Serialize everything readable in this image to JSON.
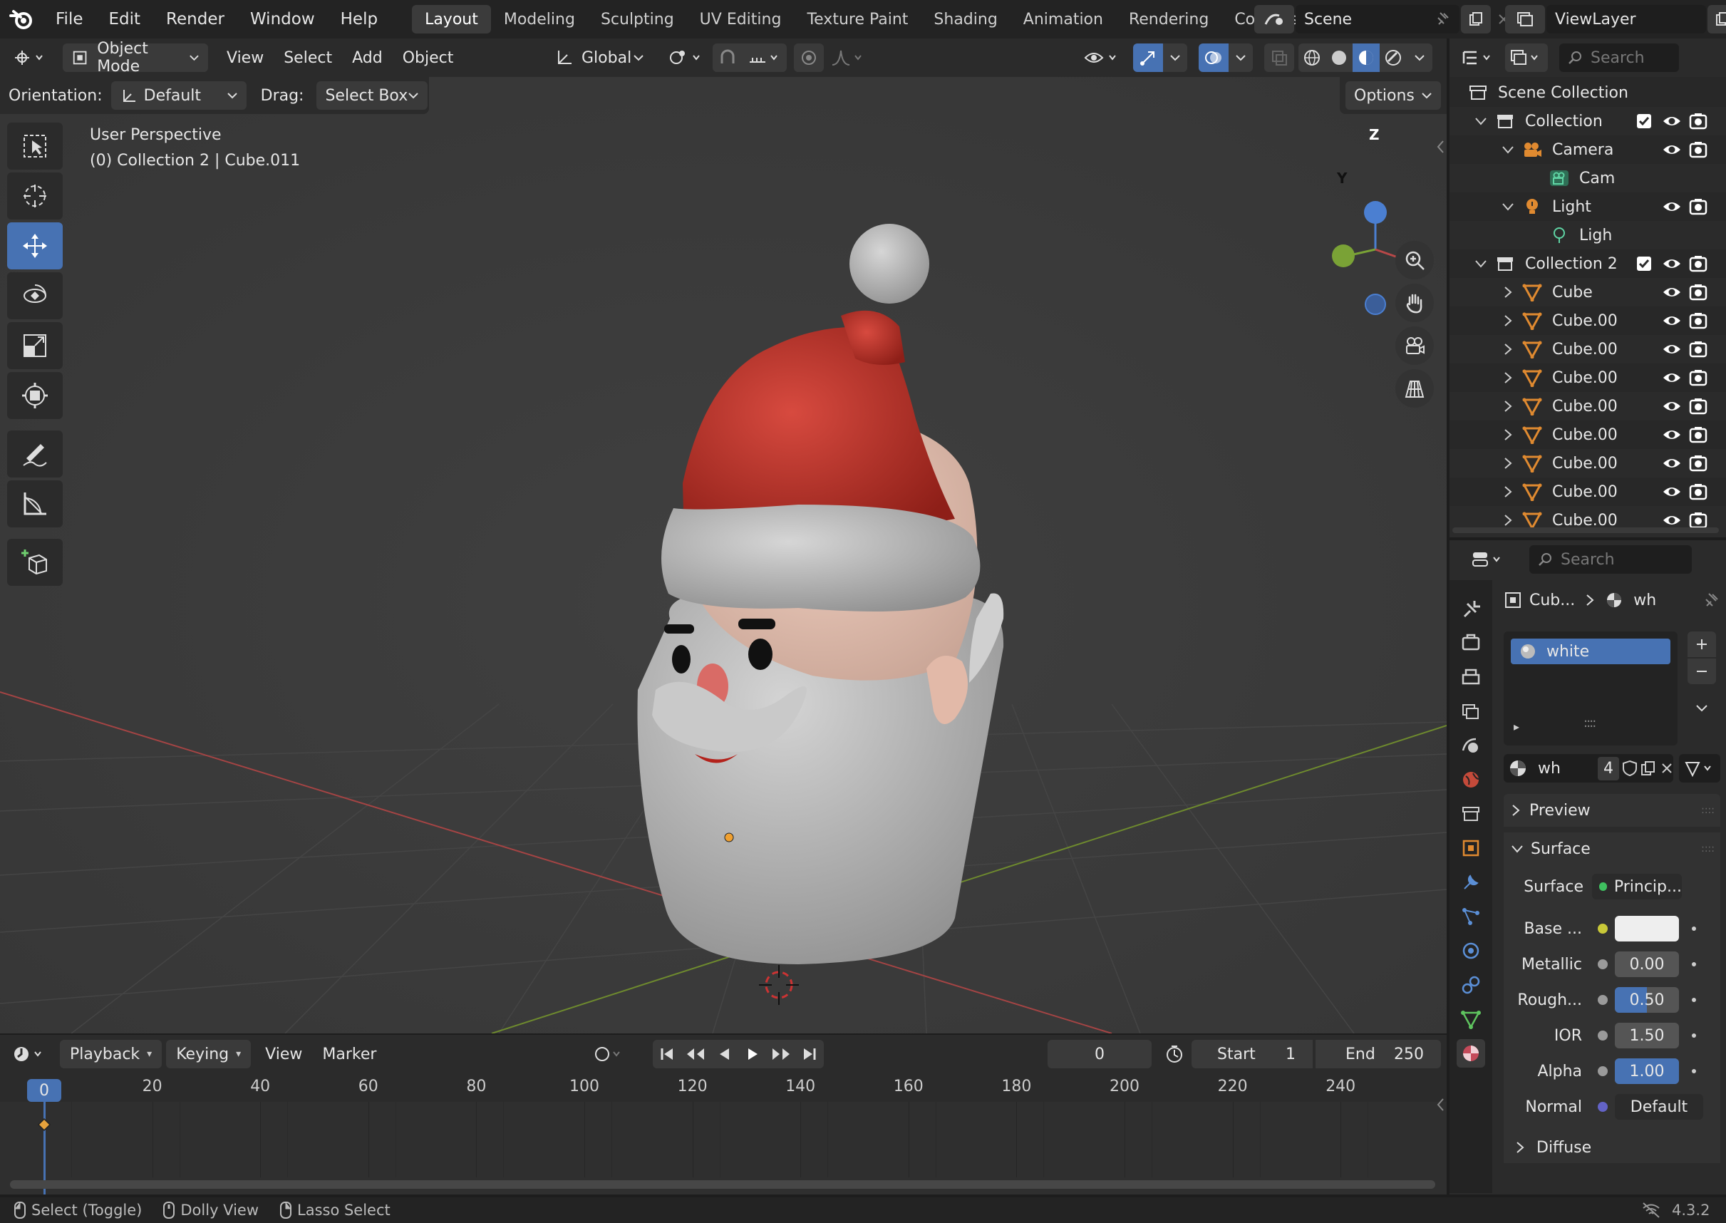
{
  "top_menu": [
    "File",
    "Edit",
    "Render",
    "Window",
    "Help"
  ],
  "workspaces": [
    {
      "label": "Layout",
      "active": true
    },
    {
      "label": "Modeling"
    },
    {
      "label": "Sculpting"
    },
    {
      "label": "UV Editing"
    },
    {
      "label": "Texture Paint"
    },
    {
      "label": "Shading"
    },
    {
      "label": "Animation"
    },
    {
      "label": "Rendering"
    },
    {
      "label": "Compositi"
    }
  ],
  "scene_name": "Scene",
  "view_layer": "ViewLayer",
  "viewport_header": {
    "mode": "Object Mode",
    "menus": [
      "View",
      "Select",
      "Add",
      "Object"
    ],
    "transform": "Global"
  },
  "tool_settings": {
    "orientation_label": "Orientation:",
    "orientation_value": "Default",
    "drag_label": "Drag:",
    "drag_value": "Select Box",
    "options": "Options"
  },
  "viewport_info": {
    "line1": "User Perspective",
    "line2": "(0) Collection 2 | Cube.011"
  },
  "gizmo": {
    "z": "Z",
    "y": "Y"
  },
  "outliner": {
    "search_placeholder": "Search",
    "rows": [
      {
        "label": "Scene Collection",
        "type": "scene",
        "indent": 0
      },
      {
        "label": "Collection",
        "type": "collection",
        "indent": 1,
        "expanded": true
      },
      {
        "label": "Camera",
        "type": "camera",
        "indent": 2,
        "expanded": true
      },
      {
        "label": "Cam",
        "type": "camera-data",
        "indent": 3
      },
      {
        "label": "Light",
        "type": "light",
        "indent": 2,
        "expanded": true
      },
      {
        "label": "Ligh",
        "type": "light-data",
        "indent": 3
      },
      {
        "label": "Collection 2",
        "type": "collection",
        "indent": 1,
        "expanded": true
      },
      {
        "label": "Cube",
        "type": "mesh",
        "indent": 2
      },
      {
        "label": "Cube.00",
        "type": "mesh",
        "indent": 2
      },
      {
        "label": "Cube.00",
        "type": "mesh",
        "indent": 2
      },
      {
        "label": "Cube.00",
        "type": "mesh",
        "indent": 2
      },
      {
        "label": "Cube.00",
        "type": "mesh",
        "indent": 2
      },
      {
        "label": "Cube.00",
        "type": "mesh",
        "indent": 2
      },
      {
        "label": "Cube.00",
        "type": "mesh",
        "indent": 2
      },
      {
        "label": "Cube.00",
        "type": "mesh",
        "indent": 2
      },
      {
        "label": "Cube.00",
        "type": "mesh",
        "indent": 2
      }
    ]
  },
  "properties": {
    "search_placeholder": "Search",
    "breadcrumb_object": "Cub...",
    "breadcrumb_material": "wh",
    "material_slot": "white",
    "material_name": "wh",
    "material_users": "4",
    "panels": {
      "preview": "Preview",
      "surface": "Surface",
      "diffuse": "Diffuse"
    },
    "surface_label": "Surface",
    "surface_value": "Princip...",
    "fields": [
      {
        "label": "Base ...",
        "value": "",
        "type": "color",
        "dot": "#c8c838"
      },
      {
        "label": "Metallic",
        "value": "0.00",
        "type": "num",
        "dot": "#9a9a9a",
        "fill": 0
      },
      {
        "label": "Rough...",
        "value": "0.50",
        "type": "num",
        "dot": "#9a9a9a",
        "fill": 0.5
      },
      {
        "label": "IOR",
        "value": "1.50",
        "type": "num",
        "dot": "#9a9a9a",
        "fill": 0
      },
      {
        "label": "Alpha",
        "value": "1.00",
        "type": "num",
        "dot": "#9a9a9a",
        "fill": 1
      },
      {
        "label": "Normal",
        "value": "Default",
        "type": "link",
        "dot": "#6363c7"
      }
    ]
  },
  "timeline": {
    "menus": [
      "Playback",
      "Keying",
      "View",
      "Marker"
    ],
    "current_frame": "0",
    "start_label": "Start",
    "start": "1",
    "end_label": "End",
    "end": "250",
    "ticks": [
      "0",
      "20",
      "40",
      "60",
      "80",
      "100",
      "120",
      "140",
      "160",
      "180",
      "200",
      "220",
      "240"
    ]
  },
  "statusbar": {
    "items": [
      "Select (Toggle)",
      "Dolly View",
      "Lasso Select"
    ],
    "version": "4.3.2"
  },
  "colors": {
    "accent": "#4772b3",
    "x_axis": "#c44a4a",
    "y_axis": "#6e9a2a",
    "hat": "#b8312a"
  }
}
